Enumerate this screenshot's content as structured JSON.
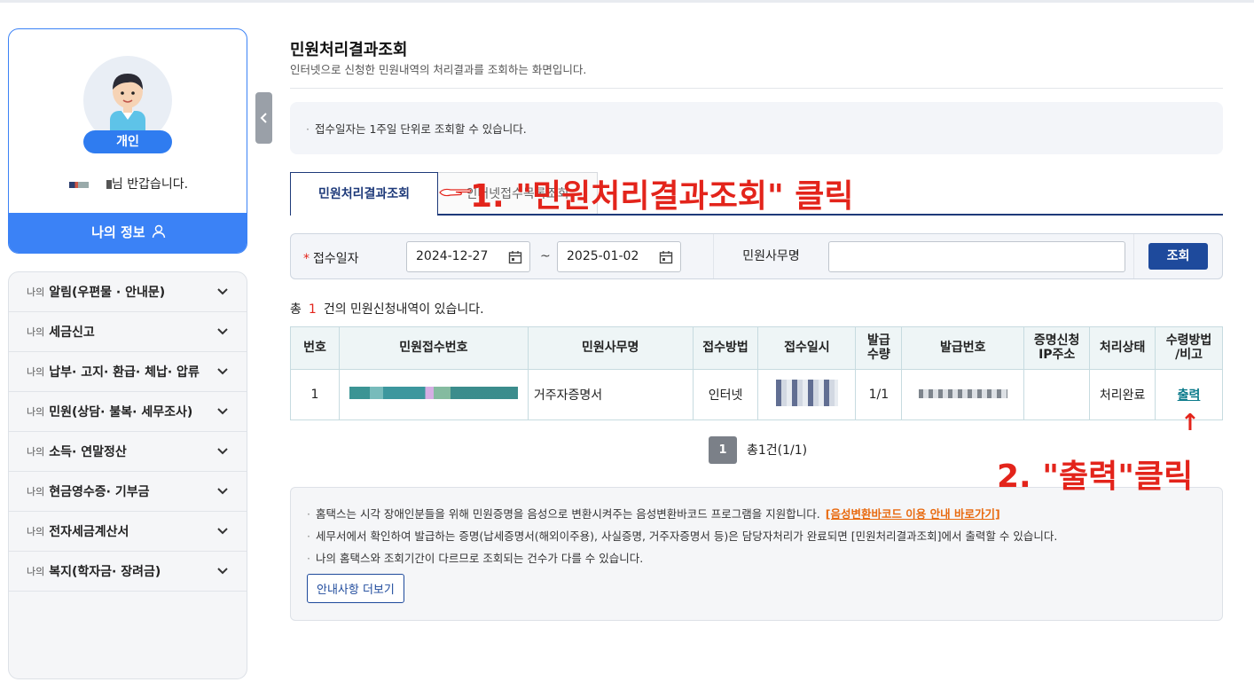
{
  "sidebar": {
    "user_type": "개인",
    "greeting": "님 반갑습니다.",
    "my_info_button": "나의 정보",
    "menu_prefix": "나의",
    "menu_items": [
      "알림(우편물 · 안내문)",
      "세금신고",
      "납부· 고지· 환급· 체납· 압류",
      "민원(상담· 불복· 세무조사)",
      "소득· 연말정산",
      "현금영수증· 기부금",
      "전자세금계산서",
      "복지(학자금· 장려금)"
    ]
  },
  "page": {
    "title": "민원처리결과조회",
    "subtitle": "인터넷으로 신청한 민원내역의 처리결과를 조회하는 화면입니다.",
    "notice": "접수일자는 1주일 단위로 조회할 수 있습니다."
  },
  "tabs": {
    "active": "민원처리결과조회",
    "inactive": "인터넷접수목록조회"
  },
  "annotations": {
    "step1": "1. \"민원처리결과조회\" 클릭",
    "step2": "2. \"출력\"클릭",
    "arrow": "↑"
  },
  "search": {
    "date_label": "접수일자",
    "required_mark": "*",
    "date_from": "2024-12-27",
    "tilde": "~",
    "date_to": "2025-01-02",
    "office_label": "민원사무명",
    "office_value": "",
    "search_button": "조회"
  },
  "results": {
    "prefix": "총",
    "count": "1",
    "suffix": "건의 민원신청내역이 있습니다.",
    "headers": [
      "번호",
      "민원접수번호",
      "민원사무명",
      "접수방법",
      "접수일시",
      "발급\n수량",
      "발급번호",
      "증명신청\nIP주소",
      "처리상태",
      "수령방법\n/비고"
    ],
    "rows": [
      {
        "no": "1",
        "office_name": "거주자증명서",
        "method": "인터넷",
        "quantity": "1/1",
        "ip": "",
        "status": "처리완료",
        "action": "출력"
      }
    ]
  },
  "pager": {
    "current": "1",
    "total_text": "총1건(1/1)"
  },
  "info": {
    "line1": "홈택스는 시각 장애인분들을 위해 민원증명을 음성으로 변환시켜주는 음성변환바코드 프로그램을 지원합니다.",
    "line1_link": "[음성변환바코드 이용 안내 바로가기]",
    "line2": "세무서에서 확인하여 발급하는 증명(납세증명서(해외이주용), 사실증명, 거주자증명서 등)은 담당자처리가 완료되면 [민원처리결과조회]에서 출력할 수 있습니다.",
    "line3": "나의 홈택스와 조회기간이 다르므로 조회되는 건수가 다를 수 있습니다.",
    "more_button": "안내사항 더보기"
  },
  "colors": {
    "primary_blue": "#3b82f6",
    "navy": "#1e3a7a",
    "annotation_red": "#e3241b",
    "link_teal": "#0a7a8a",
    "link_orange": "#e86a10"
  }
}
